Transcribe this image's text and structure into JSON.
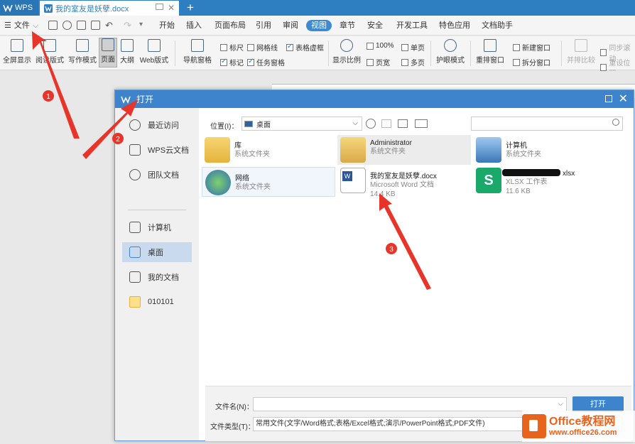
{
  "app_tab": {
    "label": "WPS"
  },
  "doc_tab": {
    "label": "我的室友是妖孽.docx"
  },
  "menu": {
    "file": "文件",
    "items": [
      "开始",
      "插入",
      "页面布局",
      "引用",
      "审阅",
      "视图",
      "章节",
      "安全",
      "开发工具",
      "特色应用",
      "文档助手"
    ],
    "active": "视图"
  },
  "ribbon": {
    "fullscreen": "全屏显示",
    "reading": "阅读版式",
    "writing": "写作模式",
    "page": "页面",
    "outline": "大纲",
    "web": "Web版式",
    "nav_pane": "导航窗格",
    "ruler": "标尺",
    "gridlines": "网格线",
    "table_grid": "表格虚框",
    "marks": "标记",
    "task_pane": "任务窗格",
    "zoom": "显示比例",
    "zoom100": "100%",
    "page_width": "页宽",
    "single": "单页",
    "multi": "多页",
    "eye": "护眼模式",
    "rearrange": "重排窗口",
    "new_window": "新建窗口",
    "split": "拆分窗口",
    "side_compare": "并排比较",
    "sync_scroll": "同步滚动",
    "reset_pos": "重设位置"
  },
  "dialog": {
    "title": "打开",
    "sidebar": [
      "最近访问",
      "WPS云文档",
      "团队文档",
      "计算机",
      "桌面",
      "我的文档",
      "010101"
    ],
    "selected_sidebar": "桌面",
    "location_label": "位置(I)：",
    "location_value": "桌面",
    "files": [
      {
        "name": "库",
        "type": "系统文件夹",
        "size": ""
      },
      {
        "name": "Administrator",
        "type": "系统文件夹",
        "size": ""
      },
      {
        "name": "计算机",
        "type": "系统文件夹",
        "size": ""
      },
      {
        "name": "网络",
        "type": "系统文件夹",
        "size": ""
      },
      {
        "name": "我的室友是妖孽.docx",
        "type": "Microsoft Word 文档",
        "size": "14.4 KB"
      },
      {
        "name": "xlsx",
        "type": "XLSX 工作表",
        "size": "11.6 KB"
      }
    ],
    "filename_label": "文件名(N)：",
    "filename_value": "",
    "filetype_label": "文件类型(T)：",
    "filetype_value": "常用文件(文字/Word格式;表格/Excel格式;演示/PowerPoint格式;PDF文件)",
    "open_button": "打开"
  },
  "annotations": {
    "n1": "1",
    "n2": "2",
    "n3": "3"
  },
  "watermark": {
    "brand": "Office教程网",
    "url": "www.office26.com"
  }
}
